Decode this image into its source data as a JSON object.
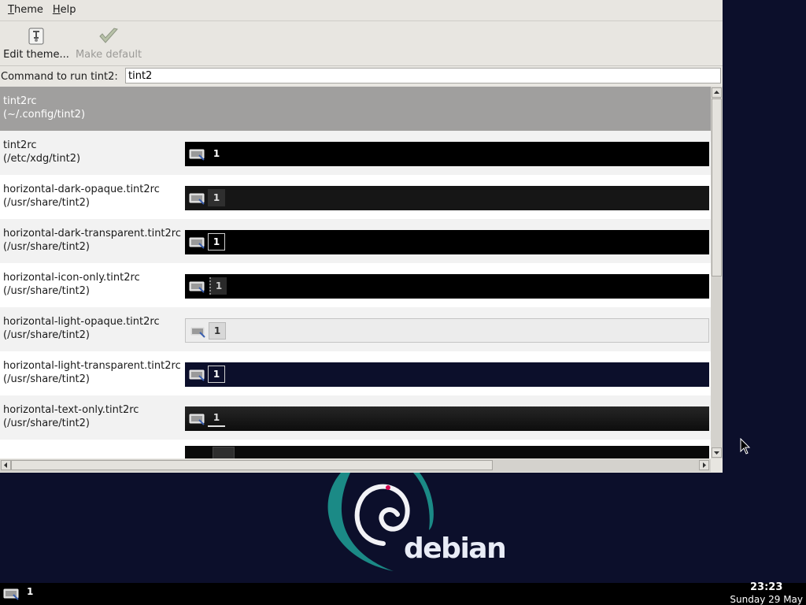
{
  "menu": [
    {
      "label": "Theme",
      "mnemonic": "T",
      "rest": "heme"
    },
    {
      "label": "Help",
      "mnemonic": "H",
      "rest": "elp"
    }
  ],
  "toolbar": {
    "edit_label": "Edit theme...",
    "make_default_label": "Make default",
    "edit_icon": "edit-theme-icon",
    "make_default_icon": "checkmark-icon"
  },
  "command": {
    "label": "Command to run tint2:",
    "value": "tint2"
  },
  "themes": [
    {
      "file": "tint2rc",
      "path": "(~/.config/tint2)",
      "selected": true,
      "preview": "none"
    },
    {
      "file": "tint2rc",
      "path": "(/etc/xdg/tint2)",
      "preview": "dark"
    },
    {
      "file": "horizontal-dark-opaque.tint2rc",
      "path": "(/usr/share/tint2)",
      "preview": "dark-opaque"
    },
    {
      "file": "horizontal-dark-transparent.tint2rc",
      "path": "(/usr/share/tint2)",
      "preview": "dark-transparent"
    },
    {
      "file": "horizontal-icon-only.tint2rc",
      "path": "(/usr/share/tint2)",
      "preview": "icon-only"
    },
    {
      "file": "horizontal-light-opaque.tint2rc",
      "path": "(/usr/share/tint2)",
      "preview": "light-opaque"
    },
    {
      "file": "horizontal-light-transparent.tint2rc",
      "path": "(/usr/share/tint2)",
      "preview": "light-transparent"
    },
    {
      "file": "horizontal-text-only.tint2rc",
      "path": "(/usr/share/tint2)",
      "preview": "text-only"
    },
    {
      "file": "",
      "path": "",
      "preview": "partial"
    }
  ],
  "preview_workspace": "1",
  "desktop": {
    "logo_text": "debian",
    "logo_color": "#1b8a86",
    "background": "#0c0f2b"
  },
  "panel": {
    "workspace": "1",
    "time": "23:23",
    "date": "Sunday 29 May"
  }
}
